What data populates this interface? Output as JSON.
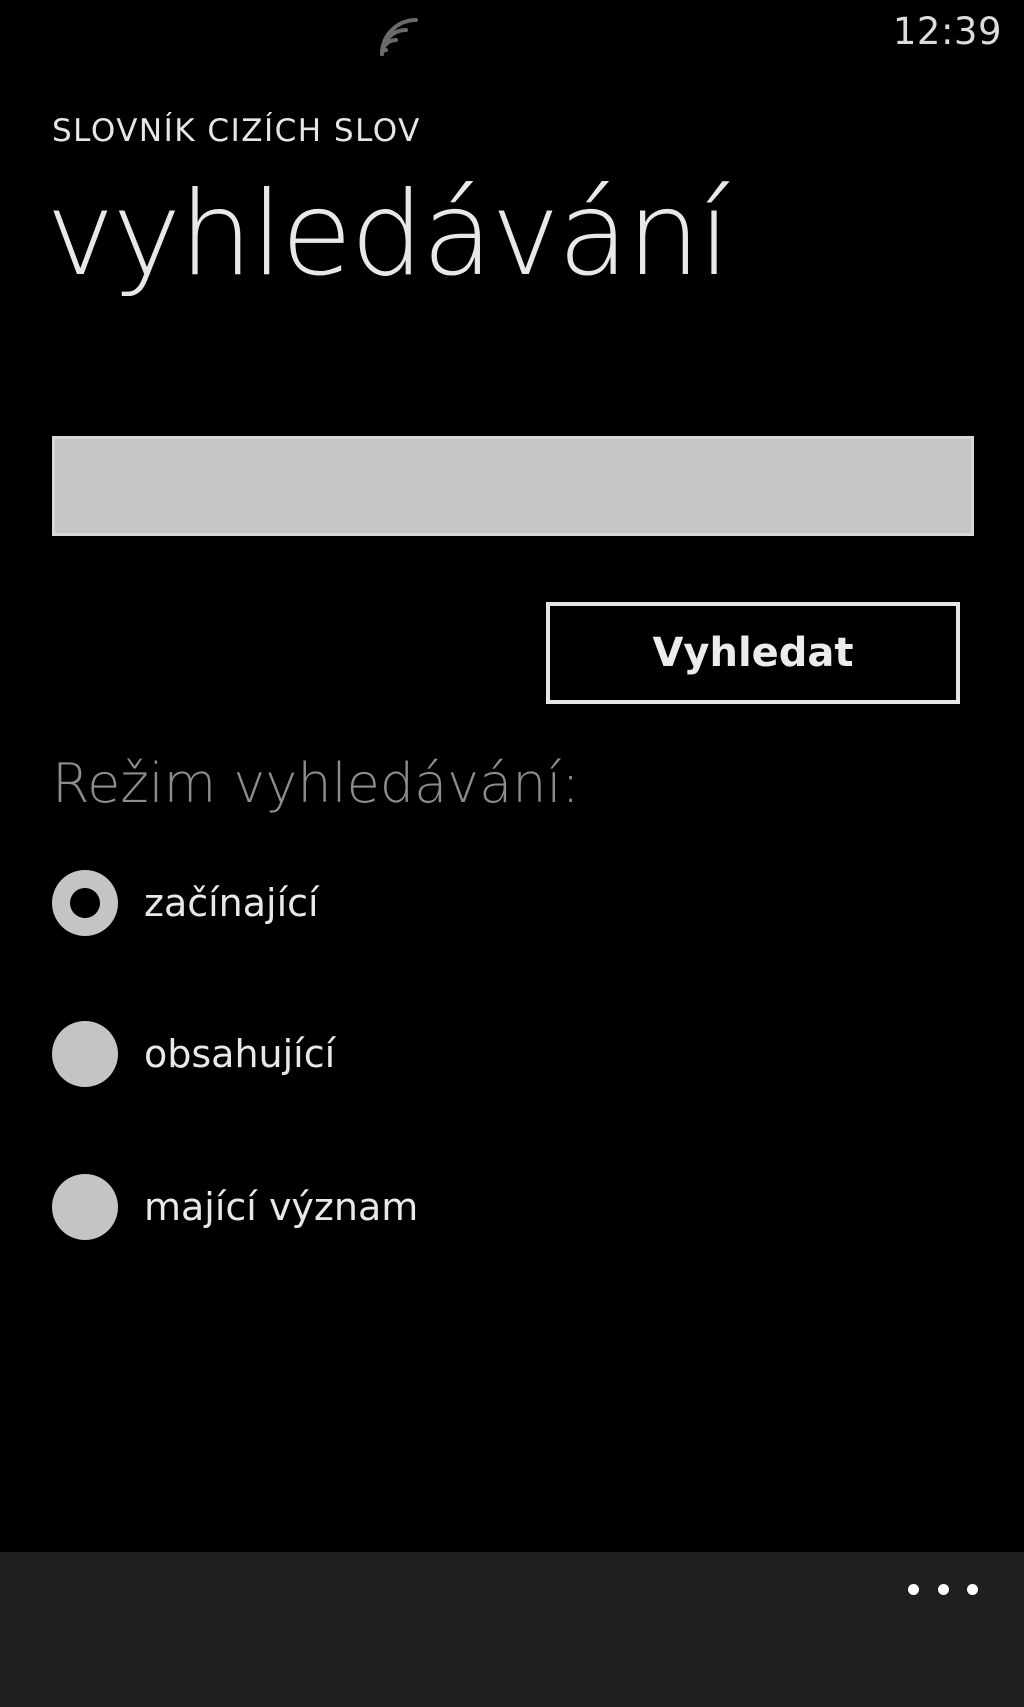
{
  "status_bar": {
    "clock": "12:39",
    "signal_icon": "wifi-signal-icon"
  },
  "header": {
    "app_title": "SLOVNÍK CIZÍCH SLOV",
    "page_title": "vyhledávání"
  },
  "search": {
    "value": "",
    "button_label": "Vyhledat"
  },
  "mode": {
    "label": "Režim vyhledávání:",
    "options": [
      {
        "label": "začínající",
        "selected": true
      },
      {
        "label": "obsahující",
        "selected": false
      },
      {
        "label": "mající význam",
        "selected": false
      }
    ]
  },
  "app_bar": {
    "more_icon": "ellipsis-icon"
  },
  "colors": {
    "background": "#000000",
    "input_fill": "#c6c6c6",
    "muted_text": "#8c8c8c",
    "app_bar": "#1f1f1f"
  }
}
